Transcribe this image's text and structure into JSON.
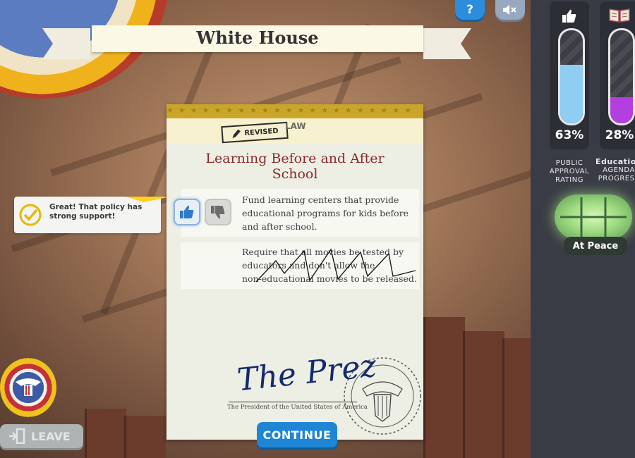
{
  "location_title": "White House",
  "top_buttons": {
    "help_label": "?"
  },
  "meters": {
    "approval": {
      "percent_text": "63%",
      "fill": 0.63,
      "label_lines": [
        "PUBLIC",
        "APPROVAL",
        "RATING"
      ],
      "icon": "thumbs-up-icon",
      "color": "#8fcdf2"
    },
    "education": {
      "percent_text": "28%",
      "fill": 0.28,
      "label_lines": [
        "Education",
        "AGENDA",
        "PROGRESS"
      ],
      "icon": "book-icon",
      "color": "#b43fe0"
    }
  },
  "status": {
    "label": "At Peace",
    "icon": "peace-lamp-icon"
  },
  "card": {
    "stamp": "REVISED",
    "type": "LAW",
    "title": "Learning Before and After School",
    "policies": [
      {
        "lines": [
          "Fund learning centers that provide",
          "educational programs for kids before",
          "and after school."
        ],
        "vote": "approved"
      },
      {
        "lines": [
          "Require that all movies be tested by",
          "educators and don't allow the",
          "non-educational movies to be released."
        ],
        "vote": "vetoed"
      }
    ],
    "signature": "The Prez",
    "signature_caption": "The President of the United States of America"
  },
  "feedback": {
    "message": "Great! That policy has strong support!",
    "icon": "checkmark-icon"
  },
  "buttons": {
    "continue": "CONTINUE",
    "leave": "LEAVE"
  },
  "colors": {
    "accent_blue": "#1f86d6",
    "card_gold": "#c9a62a",
    "title_red": "#8b2a2a"
  }
}
